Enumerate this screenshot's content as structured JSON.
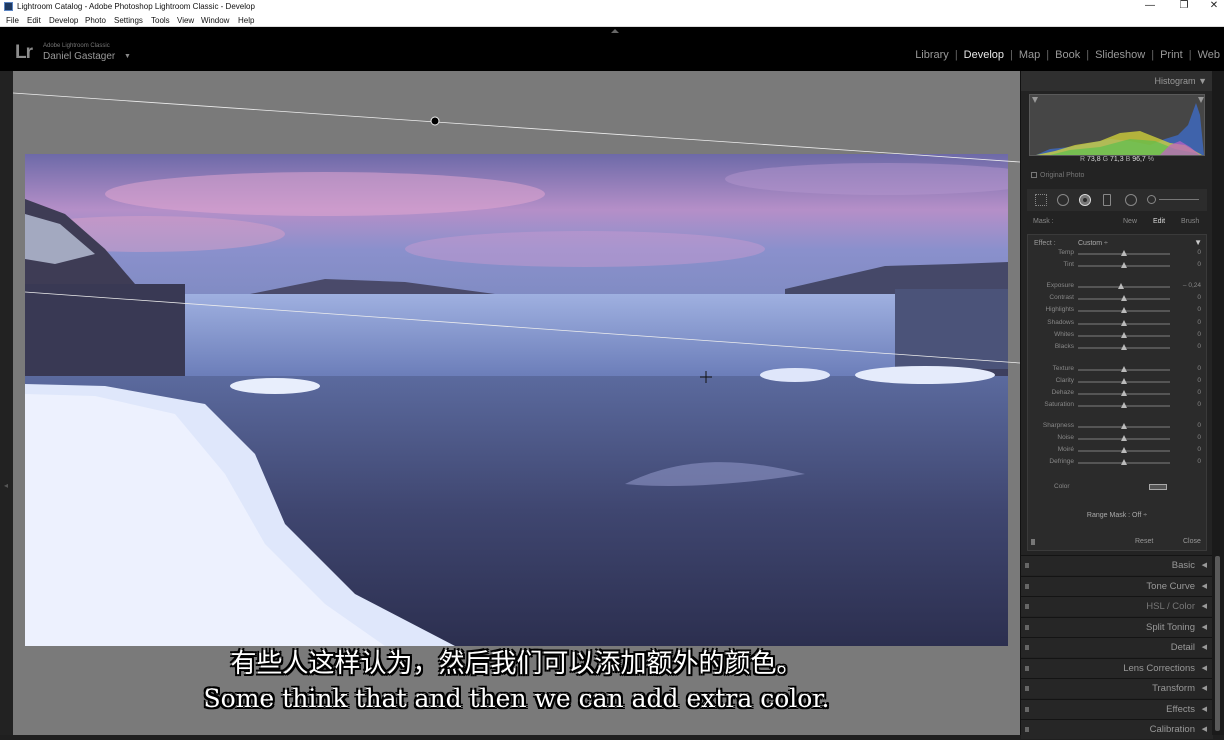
{
  "window": {
    "title": "Lightroom Catalog - Adobe Photoshop Lightroom Classic - Develop",
    "minimize": "—",
    "restore": "❐",
    "close": "✕"
  },
  "menu": [
    "File",
    "Edit",
    "Develop",
    "Photo",
    "Settings",
    "Tools",
    "View",
    "Window",
    "Help"
  ],
  "identity": {
    "logo": "Lr",
    "product": "Adobe Lightroom Classic",
    "user": "Daniel Gastager",
    "caret": "▼"
  },
  "modules": {
    "items": [
      "Library",
      "Develop",
      "Map",
      "Book",
      "Slideshow",
      "Print",
      "Web"
    ],
    "active": "Develop",
    "sep": "|"
  },
  "subtitles": {
    "cn": "有些人这样认为，然后我们可以添加额外的颜色。",
    "en": "Some think that and then we can add extra color."
  },
  "histogram": {
    "title": "Histogram",
    "arrow": "▼",
    "r_label": "R",
    "r": "73,8",
    "g_label": "G",
    "g": "71,3",
    "b_label": "B",
    "b": "96,7",
    "pct": "%",
    "original_photo": "Original Photo"
  },
  "mask": {
    "label": "Mask :",
    "new": "New",
    "edit": "Edit",
    "brush": "Brush"
  },
  "effect": {
    "label": "Effect :",
    "value": "Custom ÷",
    "arrow": "▼"
  },
  "sliders": [
    {
      "label": "Temp",
      "value": "0",
      "pos": 0.5
    },
    {
      "label": "Tint",
      "value": "0",
      "pos": 0.5
    },
    {
      "label": "Exposure",
      "value": "– 0,24",
      "pos": 0.47
    },
    {
      "label": "Contrast",
      "value": "0",
      "pos": 0.5
    },
    {
      "label": "Highlights",
      "value": "0",
      "pos": 0.5
    },
    {
      "label": "Shadows",
      "value": "0",
      "pos": 0.5
    },
    {
      "label": "Whites",
      "value": "0",
      "pos": 0.5
    },
    {
      "label": "Blacks",
      "value": "0",
      "pos": 0.5
    },
    {
      "label": "Texture",
      "value": "0",
      "pos": 0.5
    },
    {
      "label": "Clarity",
      "value": "0",
      "pos": 0.5
    },
    {
      "label": "Dehaze",
      "value": "0",
      "pos": 0.5
    },
    {
      "label": "Saturation",
      "value": "0",
      "pos": 0.5
    },
    {
      "label": "Sharpness",
      "value": "0",
      "pos": 0.5
    },
    {
      "label": "Noise",
      "value": "0",
      "pos": 0.5
    },
    {
      "label": "Moiré",
      "value": "0",
      "pos": 0.5
    },
    {
      "label": "Defringe",
      "value": "0",
      "pos": 0.5
    }
  ],
  "color": {
    "label": "Color"
  },
  "range_mask": {
    "text": "Range Mask : Off ÷"
  },
  "buttons": {
    "reset": "Reset",
    "close": "Close"
  },
  "sections": [
    {
      "label": "Basic",
      "arrow": "◀"
    },
    {
      "label": "Tone Curve",
      "arrow": "◀"
    },
    {
      "label": "HSL / Color",
      "arrow": "◀"
    },
    {
      "label": "Split Toning",
      "arrow": "◀"
    },
    {
      "label": "Detail",
      "arrow": "◀"
    },
    {
      "label": "Lens Corrections",
      "arrow": "◀"
    },
    {
      "label": "Transform",
      "arrow": "◀"
    },
    {
      "label": "Effects",
      "arrow": "◀"
    },
    {
      "label": "Calibration",
      "arrow": "◀"
    }
  ],
  "colors": {
    "accent_active": "#e8e8e8",
    "panel_bg": "#232323",
    "canvas_bg": "#7a7a7a"
  }
}
